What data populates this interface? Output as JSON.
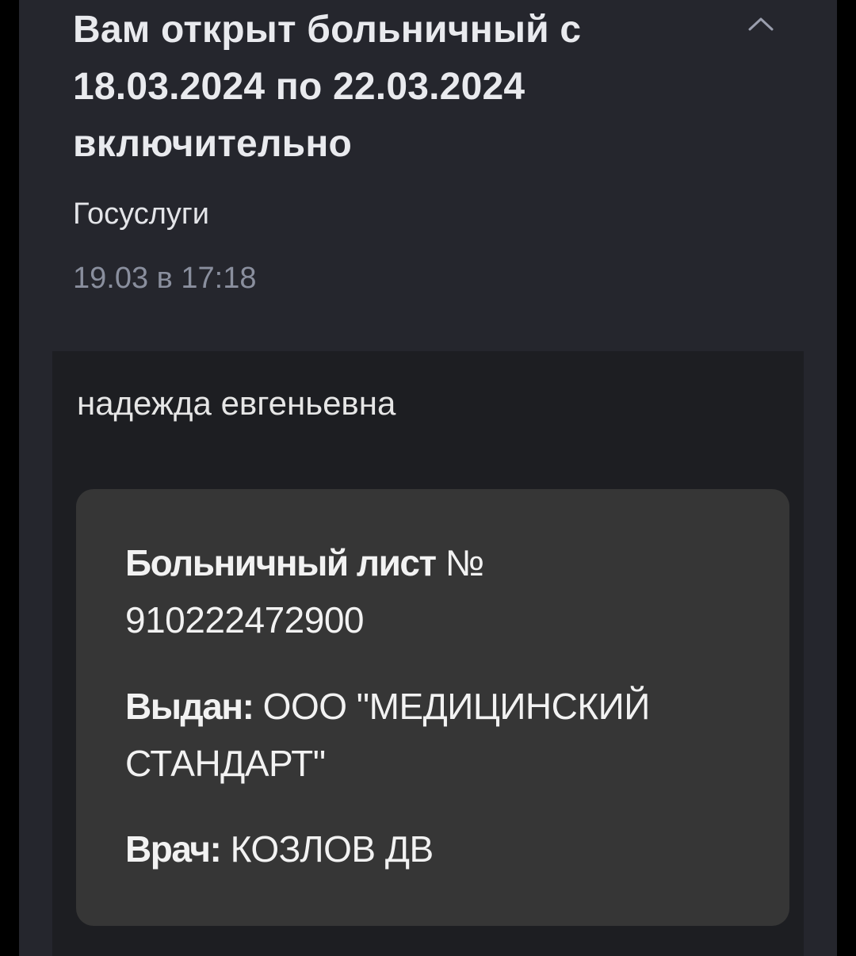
{
  "message": {
    "title": "Вам открыт больничный с 18.03.2024 по 22.03.2024 включительно",
    "sender": "Госуслуги",
    "datetime": "19.03 в 17:18"
  },
  "body": {
    "greeting": "надежда евгеньевна",
    "card": {
      "sick_leave_label": "Больничный лист",
      "sick_leave_value": "№ 910222472900",
      "issued_label": "Выдан:",
      "issued_value": "ООО \"МЕДИЦИНСКИЙ СТАНДАРТ\"",
      "doctor_label": "Врач:",
      "doctor_value": "КОЗЛОВ ДВ"
    }
  },
  "icons": {
    "collapse": "chevron-up-icon"
  },
  "colors": {
    "page_background": "#000000",
    "panel_background": "#25262d",
    "body_background": "#1d1e22",
    "card_background": "#363636",
    "title_text": "#e9eaee",
    "muted_text": "#8a8f9e"
  }
}
